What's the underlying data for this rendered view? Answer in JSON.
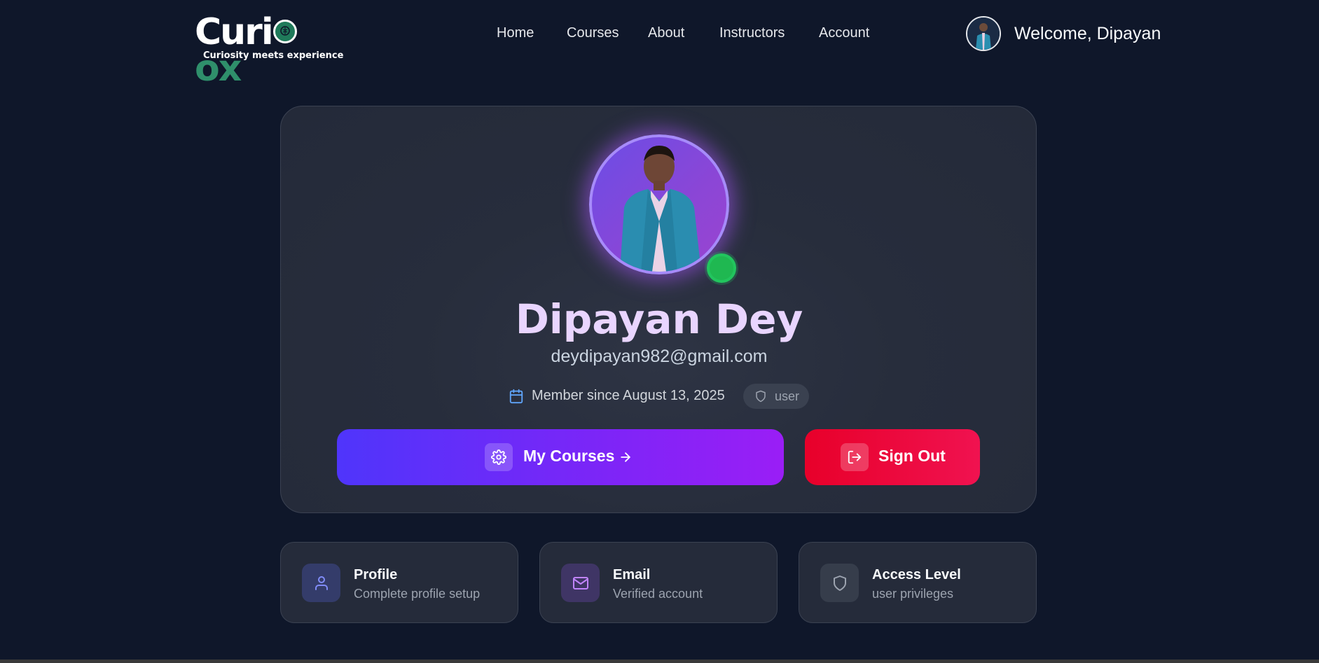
{
  "brand": {
    "logo_text_part1": "Curi",
    "logo_text_part2": "ox",
    "tagline": "Curiosity meets experience"
  },
  "nav": {
    "items": [
      {
        "label": "Home"
      },
      {
        "label": "Courses"
      },
      {
        "label": "About"
      },
      {
        "label": "Instructors"
      },
      {
        "label": "Account"
      }
    ]
  },
  "user": {
    "welcome": "Welcome, Dipayan",
    "status": "online"
  },
  "profile": {
    "name": "Dipayan Dey",
    "email": "deydipayan982@gmail.com",
    "member_since": "Member since August 13, 2025",
    "role": "user"
  },
  "actions": {
    "my_courses_label": "My Courses",
    "sign_out_label": "Sign Out"
  },
  "info_cards": [
    {
      "title": "Profile",
      "subtitle": "Complete profile setup",
      "icon": "user-icon"
    },
    {
      "title": "Email",
      "subtitle": "Verified account",
      "icon": "mail-icon"
    },
    {
      "title": "Access Level",
      "subtitle": "user privileges",
      "icon": "shield-icon"
    }
  ],
  "colors": {
    "background": "#0f172a",
    "card": "#272d3c",
    "primary_gradient_start": "#4f35fb",
    "primary_gradient_end": "#9a1ef6",
    "danger": "#e8002a",
    "online": "#22c55e",
    "name_text": "#e9d5ff",
    "brand_green": "#2f8f6b"
  }
}
